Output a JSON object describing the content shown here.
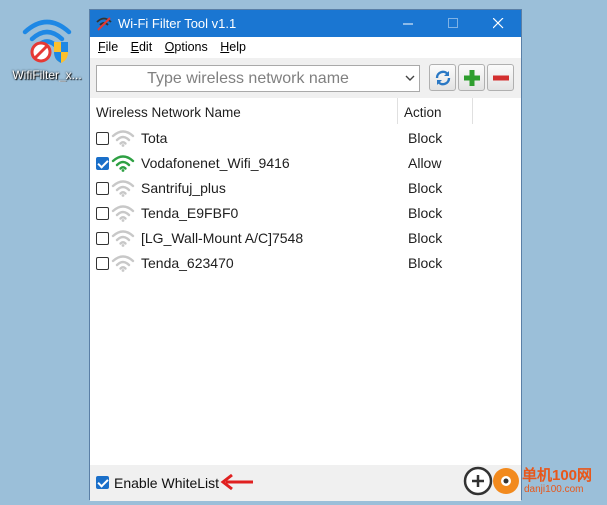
{
  "desktop": {
    "icon_label": "WifiFilter_x..."
  },
  "window": {
    "title": "Wi-Fi Filter Tool v1.1",
    "controls": {
      "minimize": "minimize-icon",
      "maximize": "maximize-icon",
      "close": "close-icon"
    }
  },
  "menu": {
    "items": [
      "File",
      "Edit",
      "Options",
      "Help"
    ]
  },
  "toolbar": {
    "network_placeholder": "Type wireless network name",
    "buttons": {
      "refresh": "refresh-icon",
      "add": "plus-icon",
      "delete": "minus-icon"
    }
  },
  "table": {
    "headers": {
      "name": "Wireless Network Name",
      "action": "Action"
    },
    "rows": [
      {
        "checked": false,
        "name": "Tota",
        "action": "Block",
        "signal_color": "#c8c8c8"
      },
      {
        "checked": true,
        "name": "Vodafonenet_Wifi_9416",
        "action": "Allow",
        "signal_color": "#2ea043"
      },
      {
        "checked": false,
        "name": "Santrifuj_plus",
        "action": "Block",
        "signal_color": "#c8c8c8"
      },
      {
        "checked": false,
        "name": "Tenda_E9FBF0",
        "action": "Block",
        "signal_color": "#c8c8c8"
      },
      {
        "checked": false,
        "name": "[LG_Wall-Mount A/C]7548",
        "action": "Block",
        "signal_color": "#c8c8c8"
      },
      {
        "checked": false,
        "name": "Tenda_623470",
        "action": "Block",
        "signal_color": "#c8c8c8"
      }
    ]
  },
  "status": {
    "whitelist_label": "Enable WhiteList",
    "whitelist_checked": true
  },
  "watermark": {
    "line1": "单机100网",
    "line2": "danji100.com"
  },
  "colors": {
    "titlebar": "#1a76d2",
    "desktop": "#9bbfd9",
    "accent_red": "#e02020",
    "allow_green": "#2ea043"
  }
}
